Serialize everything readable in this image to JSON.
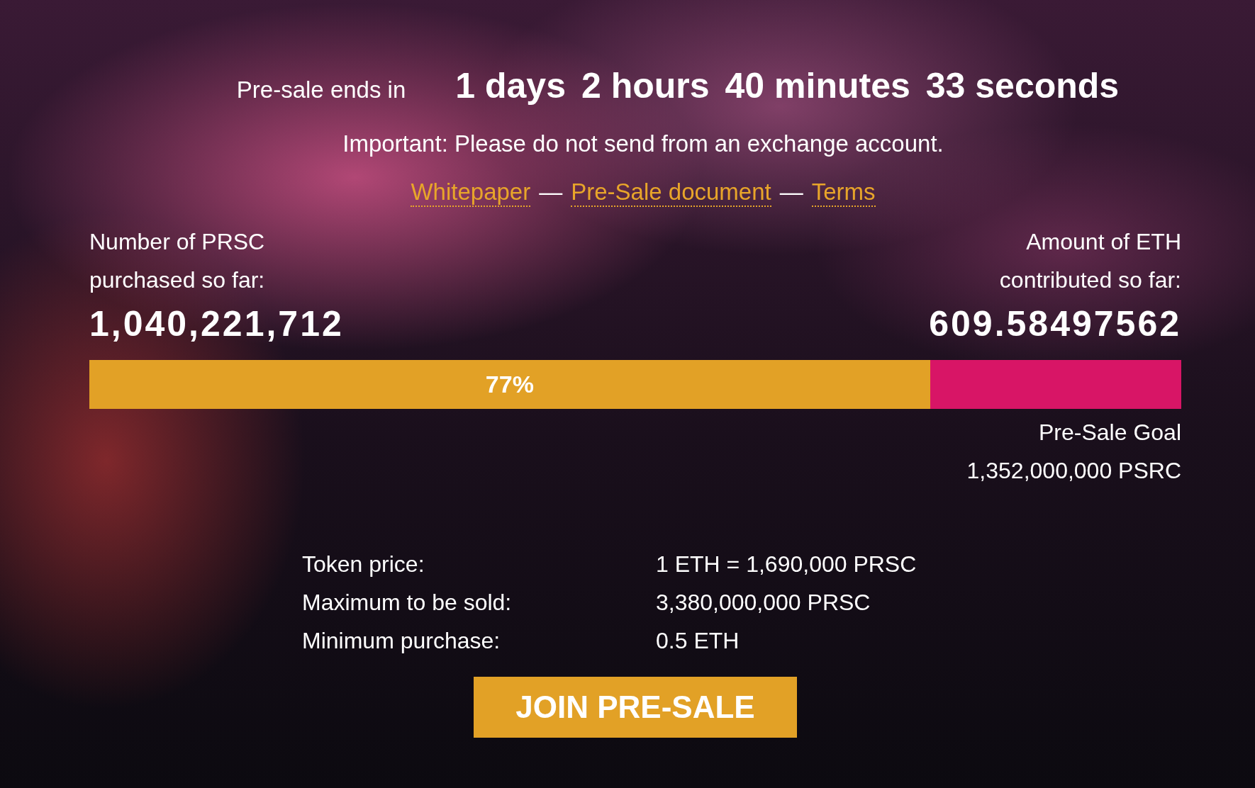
{
  "countdown": {
    "label": "Pre-sale ends in",
    "units": [
      "1 days",
      "2 hours",
      "40 minutes",
      "33 seconds"
    ]
  },
  "notice": "Important: Please do not send from an exchange account.",
  "links": [
    {
      "label": "Whitepaper"
    },
    {
      "label": "Pre-Sale document"
    },
    {
      "label": "Terms"
    }
  ],
  "link_separator": "—",
  "stats": [
    {
      "label": "Number of PRSC purchased so far:",
      "value": "1,040,221,712"
    },
    {
      "label": "Amount of ETH contributed so far:",
      "value": "609.58497562"
    }
  ],
  "progress": {
    "level": 0.77,
    "label": "77%"
  },
  "goal": {
    "label": "Pre-Sale Goal",
    "value": "1,352,000,000 PSRC"
  },
  "details": [
    {
      "label": "Token price:",
      "value": "1 ETH = 1,690,000 PRSC"
    },
    {
      "label": "Maximum to be sold:",
      "value": "3,380,000,000 PRSC"
    },
    {
      "label": "Minimum purchase:",
      "value": "0.5 ETH"
    }
  ],
  "button": "JOIN PRE-SALE"
}
